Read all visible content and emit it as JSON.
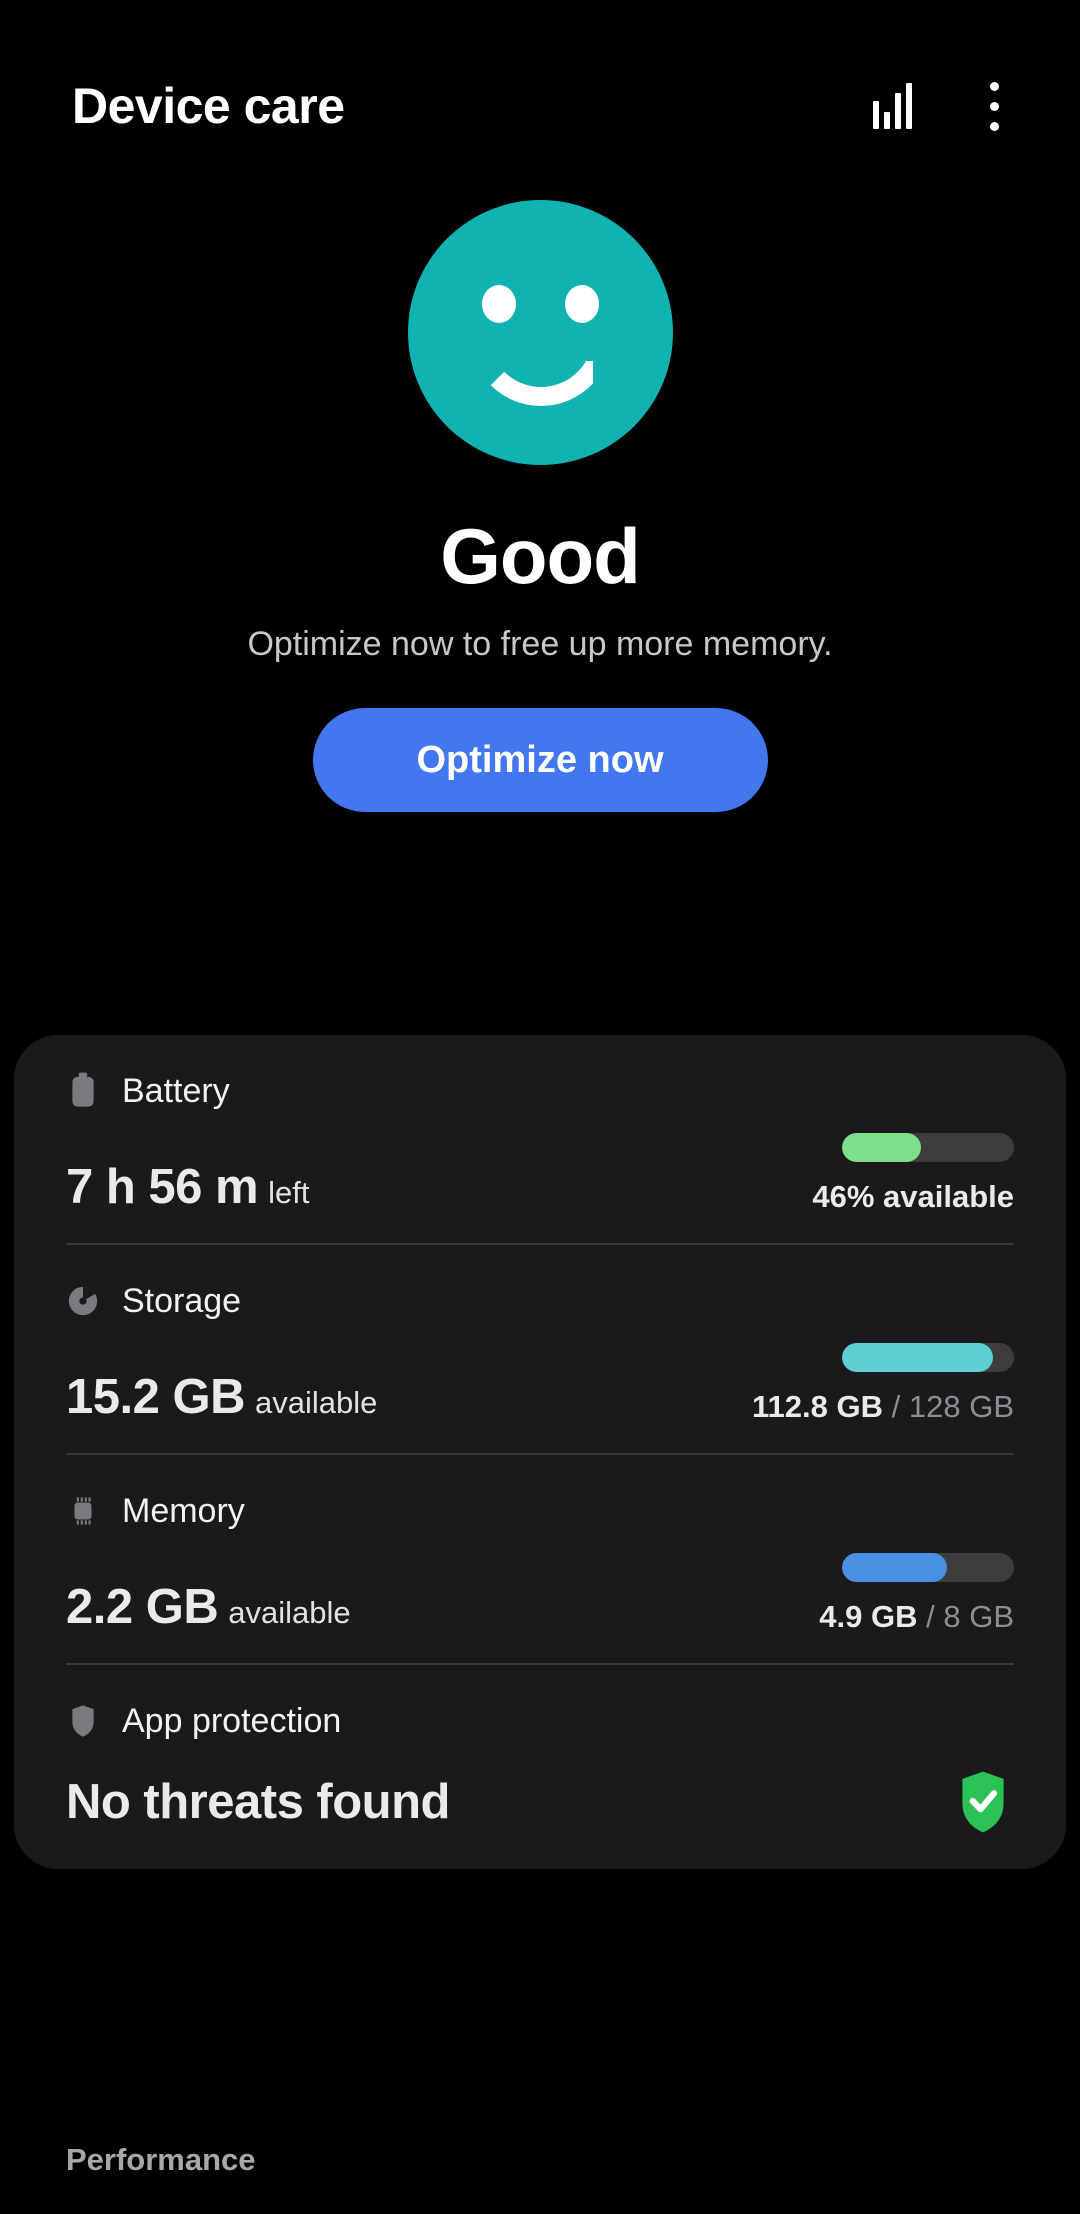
{
  "appbar": {
    "title": "Device care",
    "usage_icon": "bar-chart-icon",
    "overflow_icon": "more-vertical-icon"
  },
  "hero": {
    "face_icon": "smiley-face-icon",
    "status": "Good",
    "subtitle": "Optimize now to free up more memory.",
    "optimize_label": "Optimize now",
    "face_color": "#10b2b2",
    "button_color": "#4277f0"
  },
  "card": {
    "rows": [
      {
        "id": "battery",
        "icon": "battery-icon",
        "label": "Battery",
        "value": "7 h 56 m",
        "value_unit": "left",
        "gauge_percent": 46,
        "gauge_color": "#7ee08b",
        "caption": "46% available",
        "caption_muted": ""
      },
      {
        "id": "storage",
        "icon": "storage-pie-icon",
        "label": "Storage",
        "value": "15.2 GB",
        "value_unit": "available",
        "gauge_percent": 88,
        "gauge_color": "#5ecfd4",
        "caption": "112.8 GB",
        "caption_muted": "/ 128 GB"
      },
      {
        "id": "memory",
        "icon": "memory-chip-icon",
        "label": "Memory",
        "value": "2.2 GB",
        "value_unit": "available",
        "gauge_percent": 61,
        "gauge_color": "#4a90e2",
        "caption": "4.9 GB",
        "caption_muted": "/ 8 GB"
      }
    ],
    "protection": {
      "id": "app-protection",
      "icon": "shield-icon",
      "label": "App protection",
      "status": "No threats found",
      "badge_icon": "shield-check-icon",
      "badge_color": "#2bc255"
    }
  },
  "section": {
    "performance_title": "Performance"
  }
}
